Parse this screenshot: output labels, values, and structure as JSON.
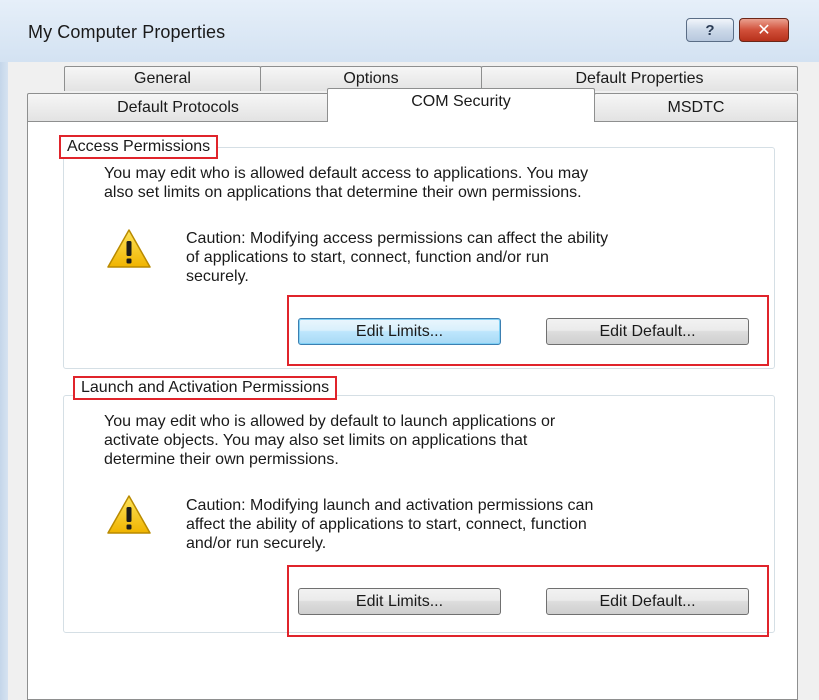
{
  "window": {
    "title": "My Computer Properties",
    "help_label": "?",
    "close_label": "✕"
  },
  "tabs": {
    "row1": [
      "General",
      "Options",
      "Default Properties"
    ],
    "row2": [
      "Default Protocols",
      "COM Security",
      "MSDTC"
    ],
    "active": "COM Security"
  },
  "access": {
    "label": "Access Permissions",
    "description_line1": "You may edit who is allowed default access to applications. You may",
    "description_line2": "also set limits on applications that determine their own permissions.",
    "caution_line1": "Caution: Modifying access permissions can affect the ability",
    "caution_line2": "of applications to start, connect, function and/or run",
    "caution_line3": "securely.",
    "edit_limits_label": "Edit Limits...",
    "edit_default_label": "Edit Default..."
  },
  "launch": {
    "label": "Launch and Activation Permissions",
    "description_line1": "You may edit who is allowed by default to launch applications or",
    "description_line2": "activate objects. You may also set limits on applications that",
    "description_line3": "determine their own permissions.",
    "caution_line1": "Caution: Modifying launch and activation permissions can",
    "caution_line2": "affect the ability of applications to start, connect, function",
    "caution_line3": "and/or run securely.",
    "edit_limits_label": "Edit Limits...",
    "edit_default_label": "Edit Default..."
  },
  "colors": {
    "highlight": "#e0242b",
    "warning_fill": "#f5c400",
    "focus_border": "#3c7fb1"
  },
  "icons": [
    "help-icon",
    "close-icon",
    "warning-icon"
  ]
}
